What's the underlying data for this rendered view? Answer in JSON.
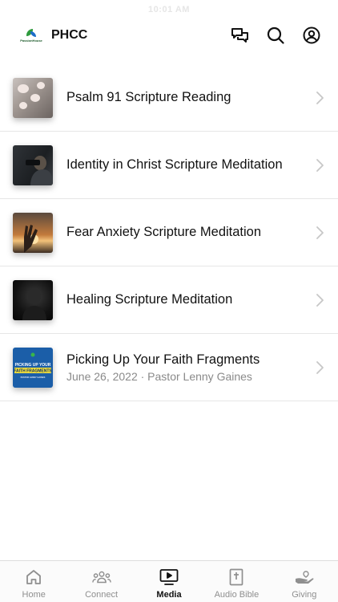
{
  "status_bar": {
    "time": "10:01 AM"
  },
  "header": {
    "logo_text": "PassionHouse",
    "title": "PHCC",
    "icons": [
      "chat-bubbles-icon",
      "search-icon",
      "account-icon"
    ]
  },
  "media": {
    "items": [
      {
        "title": "Psalm 91 Scripture Reading",
        "subtitle": "",
        "thumb": "magnolia-blossoms"
      },
      {
        "title": "Identity in Christ Scripture Meditation",
        "subtitle": "",
        "thumb": "man-with-binoculars"
      },
      {
        "title": "Fear Anxiety Scripture Meditation",
        "subtitle": "",
        "thumb": "raised-hand-sunset"
      },
      {
        "title": "Healing Scripture Meditation",
        "subtitle": "",
        "thumb": "person-in-dark"
      },
      {
        "title": "Picking Up Your Faith Fragments",
        "subtitle": "June 26, 2022 · Pastor Lenny Gaines",
        "thumb": "sermon-artwork",
        "thumb_text": {
          "line1": "PICKING UP YOUR",
          "line2": "FAITH FRAGMENTS",
          "line3": "PASTOR LENNY GAINES"
        }
      }
    ]
  },
  "tabs": [
    {
      "label": "Home",
      "icon": "home-icon",
      "active": false
    },
    {
      "label": "Connect",
      "icon": "people-icon",
      "active": false
    },
    {
      "label": "Media",
      "icon": "media-player-icon",
      "active": true
    },
    {
      "label": "Audio Bible",
      "icon": "bible-icon",
      "active": false
    },
    {
      "label": "Giving",
      "icon": "giving-hand-icon",
      "active": false
    }
  ],
  "colors": {
    "active_tab": "#111111",
    "inactive_tab": "#8f8f8f",
    "divider": "#e6e6e6",
    "thumb_blue": "#1b5ea8"
  }
}
